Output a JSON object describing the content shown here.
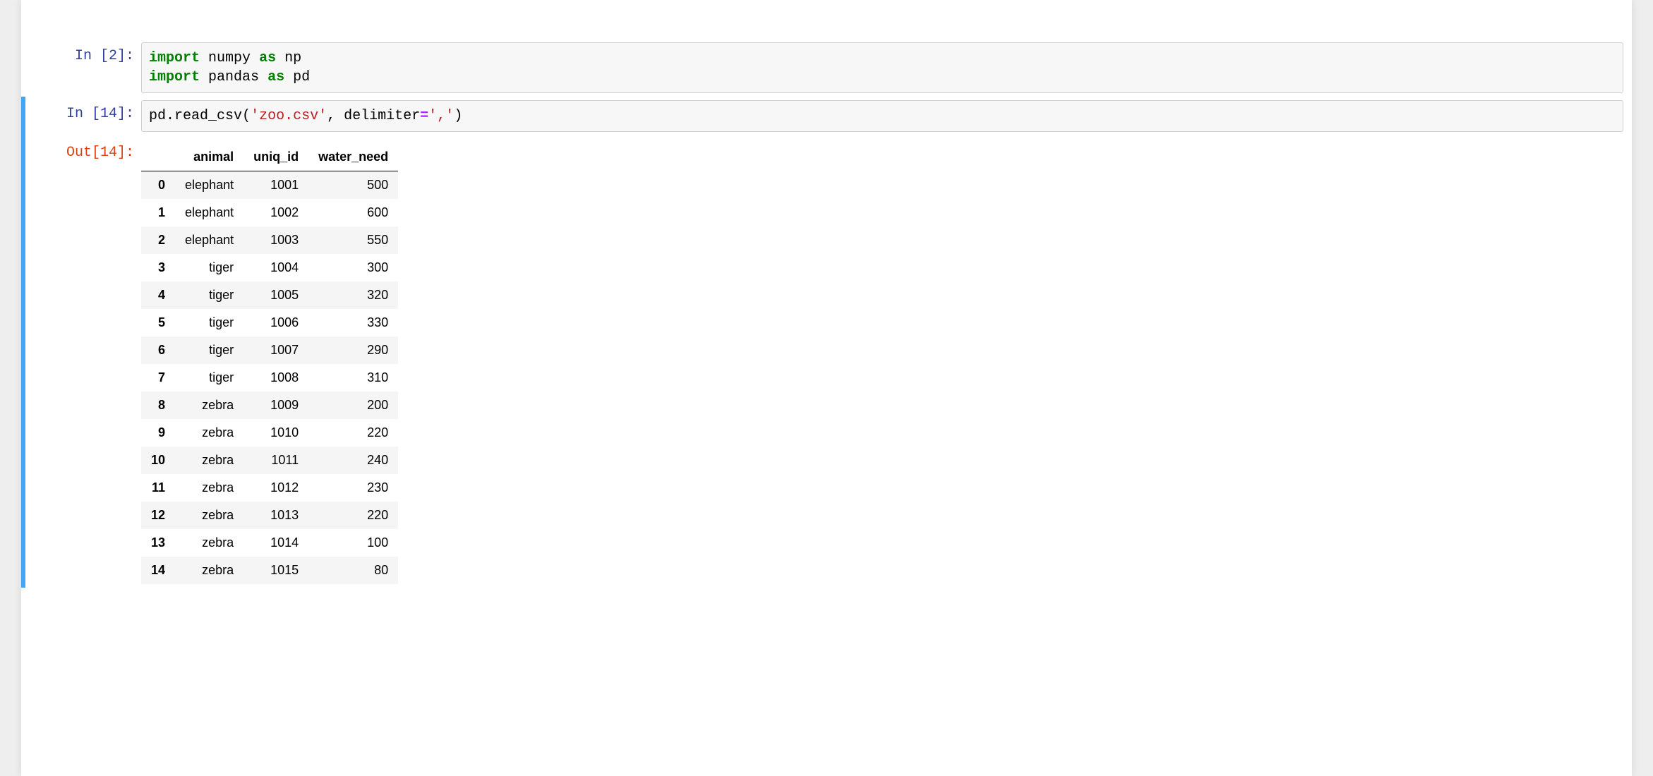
{
  "cells": [
    {
      "exec_count": 2,
      "in_prompt": "In [2]:",
      "code_tokens": [
        {
          "t": "import",
          "c": "kw"
        },
        {
          "t": " ",
          "c": ""
        },
        {
          "t": "numpy",
          "c": "nm"
        },
        {
          "t": " ",
          "c": ""
        },
        {
          "t": "as",
          "c": "kw"
        },
        {
          "t": " ",
          "c": ""
        },
        {
          "t": "np",
          "c": "nm"
        },
        {
          "t": "\n",
          "c": ""
        },
        {
          "t": "import",
          "c": "kw"
        },
        {
          "t": " ",
          "c": ""
        },
        {
          "t": "pandas",
          "c": "nm"
        },
        {
          "t": " ",
          "c": ""
        },
        {
          "t": "as",
          "c": "kw"
        },
        {
          "t": " ",
          "c": ""
        },
        {
          "t": "pd",
          "c": "nm"
        }
      ]
    },
    {
      "exec_count": 14,
      "in_prompt": "In [14]:",
      "out_prompt": "Out[14]:",
      "code_tokens": [
        {
          "t": "pd",
          "c": "nm"
        },
        {
          "t": ".",
          "c": "pun"
        },
        {
          "t": "read_csv",
          "c": "nm"
        },
        {
          "t": "(",
          "c": "pun"
        },
        {
          "t": "'zoo.csv'",
          "c": "str"
        },
        {
          "t": ",",
          "c": "pun"
        },
        {
          "t": " ",
          "c": ""
        },
        {
          "t": "delimiter",
          "c": "nm"
        },
        {
          "t": "=",
          "c": "op"
        },
        {
          "t": "','",
          "c": "str"
        },
        {
          "t": ")",
          "c": "pun"
        }
      ],
      "dataframe": {
        "columns": [
          "animal",
          "uniq_id",
          "water_need"
        ],
        "rows": [
          {
            "idx": "0",
            "animal": "elephant",
            "uniq_id": "1001",
            "water_need": "500"
          },
          {
            "idx": "1",
            "animal": "elephant",
            "uniq_id": "1002",
            "water_need": "600"
          },
          {
            "idx": "2",
            "animal": "elephant",
            "uniq_id": "1003",
            "water_need": "550"
          },
          {
            "idx": "3",
            "animal": "tiger",
            "uniq_id": "1004",
            "water_need": "300"
          },
          {
            "idx": "4",
            "animal": "tiger",
            "uniq_id": "1005",
            "water_need": "320"
          },
          {
            "idx": "5",
            "animal": "tiger",
            "uniq_id": "1006",
            "water_need": "330"
          },
          {
            "idx": "6",
            "animal": "tiger",
            "uniq_id": "1007",
            "water_need": "290"
          },
          {
            "idx": "7",
            "animal": "tiger",
            "uniq_id": "1008",
            "water_need": "310"
          },
          {
            "idx": "8",
            "animal": "zebra",
            "uniq_id": "1009",
            "water_need": "200"
          },
          {
            "idx": "9",
            "animal": "zebra",
            "uniq_id": "1010",
            "water_need": "220"
          },
          {
            "idx": "10",
            "animal": "zebra",
            "uniq_id": "1011",
            "water_need": "240"
          },
          {
            "idx": "11",
            "animal": "zebra",
            "uniq_id": "1012",
            "water_need": "230"
          },
          {
            "idx": "12",
            "animal": "zebra",
            "uniq_id": "1013",
            "water_need": "220"
          },
          {
            "idx": "13",
            "animal": "zebra",
            "uniq_id": "1014",
            "water_need": "100"
          },
          {
            "idx": "14",
            "animal": "zebra",
            "uniq_id": "1015",
            "water_need": "80"
          }
        ]
      }
    }
  ]
}
